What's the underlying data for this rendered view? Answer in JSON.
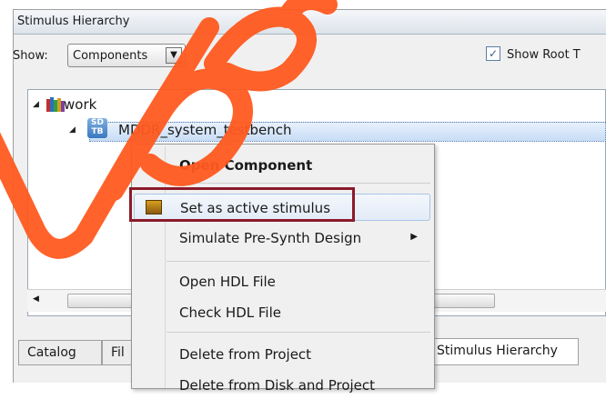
{
  "panel": {
    "title": "Stimulus Hierarchy",
    "show_label": "Show:",
    "show_select_value": "Components",
    "show_root_label": "Show Root T"
  },
  "tree": {
    "root_label": "work",
    "selected_label": "MDDR_system_testbench",
    "selected_icon_text": "SD TB"
  },
  "context_menu": {
    "items": [
      {
        "label": "Open Component"
      },
      {
        "label": "Set as active stimulus"
      },
      {
        "label": "Simulate Pre-Synth Design"
      },
      {
        "label": "Open HDL File"
      },
      {
        "label": "Check HDL File"
      },
      {
        "label": "Delete from Project"
      },
      {
        "label": "Delete from Disk and Project"
      }
    ]
  },
  "tabs": [
    {
      "label": "Catalog"
    },
    {
      "label": "Fil"
    },
    {
      "label": "Stimulus Hierarchy"
    }
  ],
  "watermark_text": "upel",
  "colors": {
    "watermark": "#ff5a1f",
    "highlight_border": "#8b1a2a",
    "selection": "#c7ddf6"
  }
}
